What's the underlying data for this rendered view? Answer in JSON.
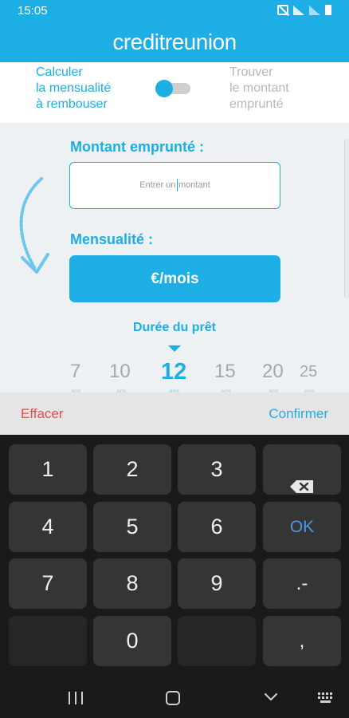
{
  "status_bar": {
    "time": "15:05",
    "icons": [
      "mute-icon",
      "wifi-icon",
      "signal-icon",
      "battery-icon"
    ]
  },
  "app": {
    "logo": "creditreunion",
    "brand_color": "#1daee6"
  },
  "mode_toggle": {
    "left_label": [
      "Calculer",
      "la mensualité",
      "à rembouser"
    ],
    "right_label": [
      "Trouver",
      "le montant",
      "emprunté"
    ],
    "state": "left"
  },
  "form": {
    "amount_label": "Montant emprunté :",
    "amount_placeholder_before": "Entrer un",
    "amount_placeholder_after": "montant",
    "monthly_label": "Mensualité :",
    "monthly_button": "€/mois",
    "duration_title": "Durée du prêt",
    "durations": [
      {
        "value": "7",
        "selected": false
      },
      {
        "value": "10",
        "selected": false
      },
      {
        "value": "12",
        "selected": true
      },
      {
        "value": "15",
        "selected": false
      },
      {
        "value": "20",
        "selected": false
      },
      {
        "value": "25",
        "selected": false
      }
    ],
    "duration_sub": "ans"
  },
  "actions": {
    "clear": "Effacer",
    "confirm": "Confirmer"
  },
  "keyboard": {
    "rows": [
      [
        "1",
        "2",
        "3",
        "backspace"
      ],
      [
        "4",
        "5",
        "6",
        "OK"
      ],
      [
        "7",
        "8",
        "9",
        ".-"
      ],
      [
        "",
        "0",
        "",
        ","
      ]
    ],
    "ok_color": "#4c97e6"
  },
  "nav_bar": {
    "icons": [
      "recent-apps-icon",
      "home-icon",
      "back-icon",
      "keyboard-icon"
    ]
  }
}
